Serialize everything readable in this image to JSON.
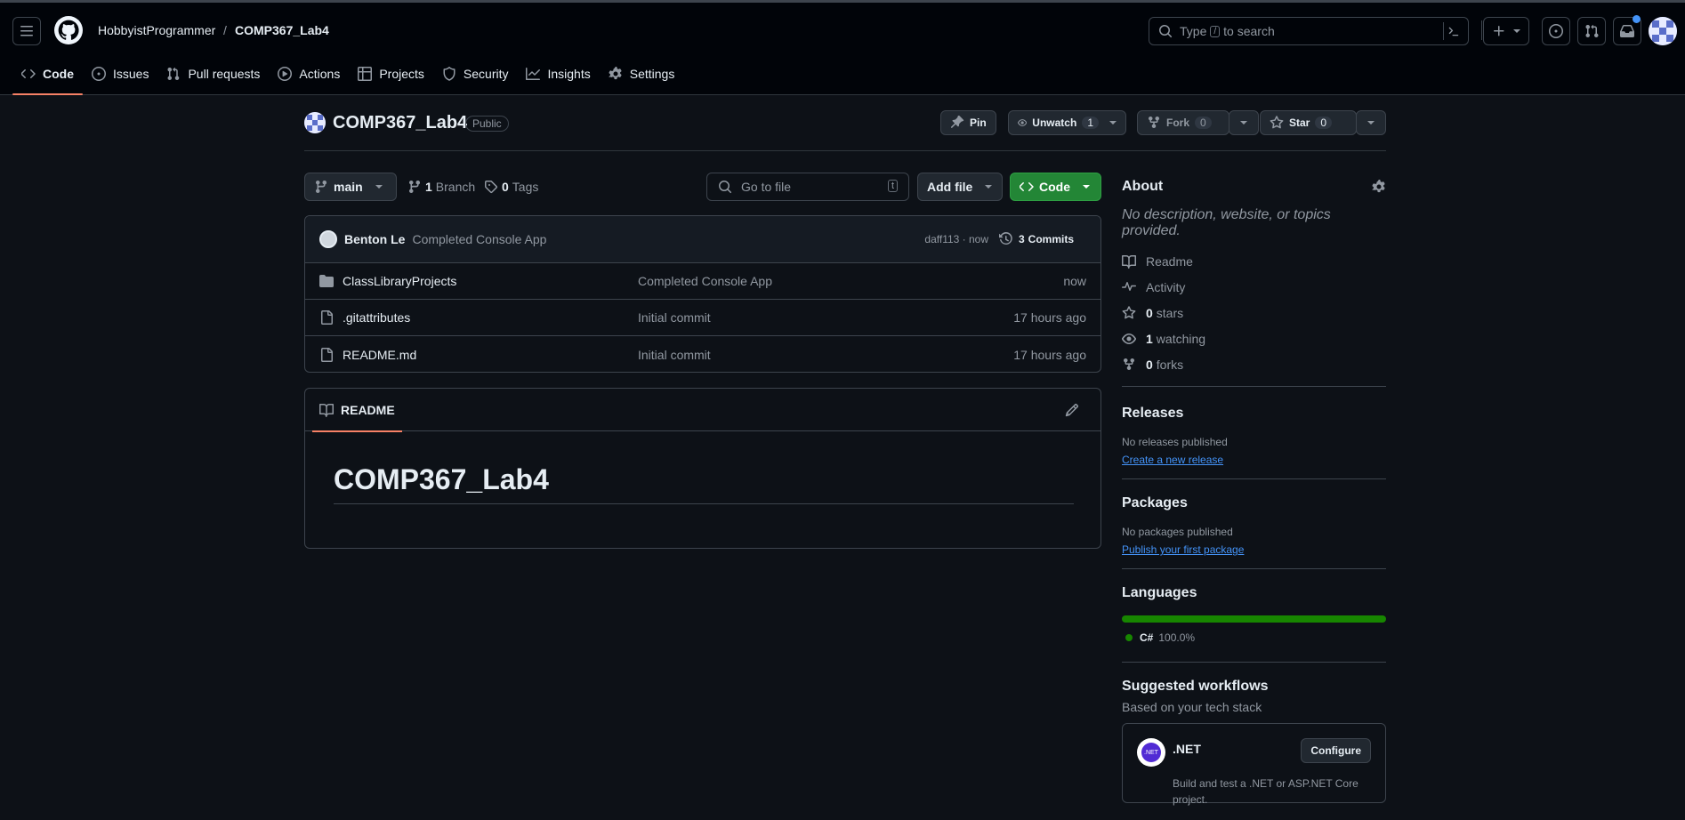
{
  "header": {
    "owner": "HobbyistProgrammer",
    "separator": "/",
    "repo": "COMP367_Lab4",
    "search": {
      "prefix": "Type",
      "key": "/",
      "suffix": "to search"
    }
  },
  "nav": {
    "tabs": [
      {
        "label": "Code"
      },
      {
        "label": "Issues"
      },
      {
        "label": "Pull requests"
      },
      {
        "label": "Actions"
      },
      {
        "label": "Projects"
      },
      {
        "label": "Security"
      },
      {
        "label": "Insights"
      },
      {
        "label": "Settings"
      }
    ]
  },
  "repo": {
    "name": "COMP367_Lab4",
    "visibility": "Public",
    "pin_label": "Pin",
    "watch_label": "Unwatch",
    "watch_count": "1",
    "fork_label": "Fork",
    "fork_count": "0",
    "star_label": "Star",
    "star_count": "0"
  },
  "toolbar": {
    "branch": "main",
    "branch_count": "1",
    "branch_label": "Branch",
    "tag_count": "0",
    "tag_label": "Tags",
    "goto_placeholder": "Go to file",
    "goto_key": "t",
    "add_file": "Add file",
    "code": "Code"
  },
  "commit": {
    "author": "Benton Le",
    "message": "Completed Console App",
    "hash": "daff113 · now",
    "commits_count": "3",
    "commits_label": "Commits"
  },
  "files": [
    {
      "name": "ClassLibraryProjects",
      "type": "folder",
      "message": "Completed Console App",
      "time": "now"
    },
    {
      "name": ".gitattributes",
      "type": "file",
      "message": "Initial commit",
      "time": "17 hours ago"
    },
    {
      "name": "README.md",
      "type": "file",
      "message": "Initial commit",
      "time": "17 hours ago"
    }
  ],
  "readme": {
    "tab": "README",
    "heading": "COMP367_Lab4"
  },
  "about": {
    "title": "About",
    "description": "No description, website, or topics provided.",
    "readme": "Readme",
    "activity": "Activity",
    "stars_count": "0",
    "stars_label": "stars",
    "watching_count": "1",
    "watching_label": "watching",
    "forks_count": "0",
    "forks_label": "forks"
  },
  "releases": {
    "title": "Releases",
    "none": "No releases published",
    "create": "Create a new release"
  },
  "packages": {
    "title": "Packages",
    "none": "No packages published",
    "publish": "Publish your first package"
  },
  "languages": {
    "title": "Languages",
    "items": [
      {
        "name": "C#",
        "percent": "100.0%",
        "fraction": 1.0,
        "color": "#178600"
      }
    ]
  },
  "workflows": {
    "title": "Suggested workflows",
    "subtitle": "Based on your tech stack",
    "card_title": ".NET",
    "card_button": "Configure",
    "card_desc": "Build and test a .NET or ASP.NET Core project."
  },
  "colors": {
    "accent": "#f78166",
    "green": "#238636",
    "link": "#4493f8"
  }
}
